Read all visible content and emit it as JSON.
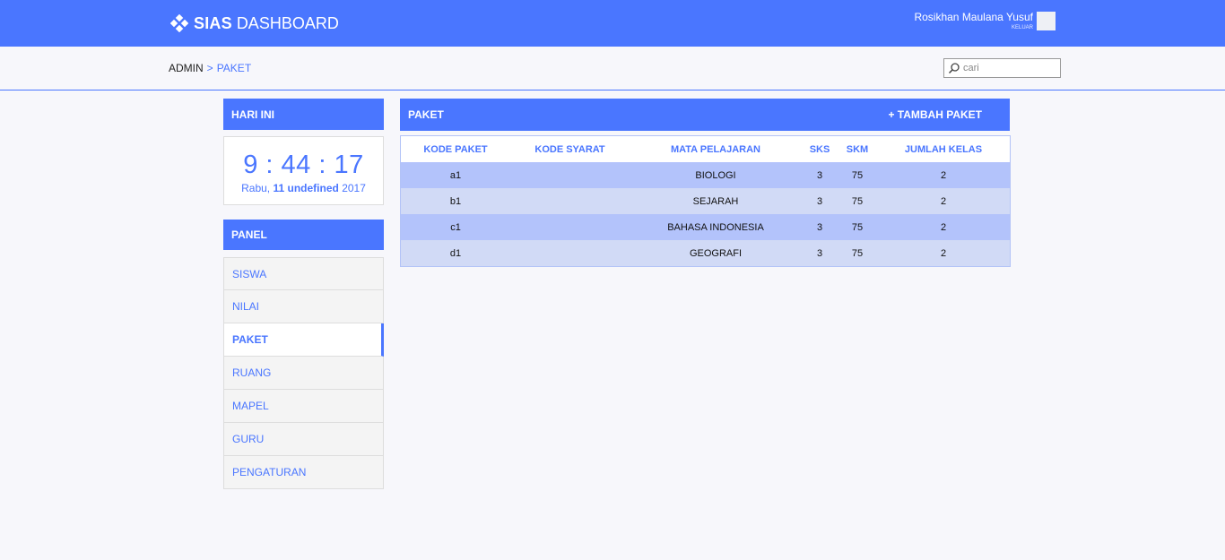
{
  "header": {
    "brand_strong": "SIAS",
    "brand_light": "DASHBOARD",
    "user_name": "Rosikhan Maulana Yusuf",
    "logout_label": "KELUAR"
  },
  "breadcrumb": {
    "root": "ADMIN",
    "separator": ">",
    "current": "PAKET"
  },
  "search": {
    "placeholder": "cari"
  },
  "today": {
    "title": "HARI INI",
    "time": "9 : 44 : 17",
    "day": "Rabu,",
    "date_bold": "11 undefined",
    "year": "2017"
  },
  "panel": {
    "title": "PANEL",
    "items": [
      {
        "label": "SISWA"
      },
      {
        "label": "NILAI"
      },
      {
        "label": "PAKET"
      },
      {
        "label": "RUANG"
      },
      {
        "label": "MAPEL"
      },
      {
        "label": "GURU"
      },
      {
        "label": "PENGATURAN"
      }
    ],
    "active": "PAKET"
  },
  "content": {
    "title": "PAKET",
    "add_label": "+ TAMBAH PAKET",
    "columns": [
      "KODE PAKET",
      "KODE SYARAT",
      "MATA PELAJARAN",
      "SKS",
      "SKM",
      "JUMLAH KELAS"
    ],
    "rows": [
      [
        "a1",
        "",
        "BIOLOGI",
        "3",
        "75",
        "2"
      ],
      [
        "b1",
        "",
        "SEJARAH",
        "3",
        "75",
        "2"
      ],
      [
        "c1",
        "",
        "BAHASA INDONESIA",
        "3",
        "75",
        "2"
      ],
      [
        "d1",
        "",
        "GEOGRAFI",
        "3",
        "75",
        "2"
      ]
    ]
  },
  "colors": {
    "accent": "#4a76ff",
    "row_odd": "#b3c3fb",
    "row_even": "#d1daf6",
    "background": "#f7f7fb"
  },
  "icons": {
    "brand": "diamond-logo-icon",
    "search": "search-icon"
  }
}
